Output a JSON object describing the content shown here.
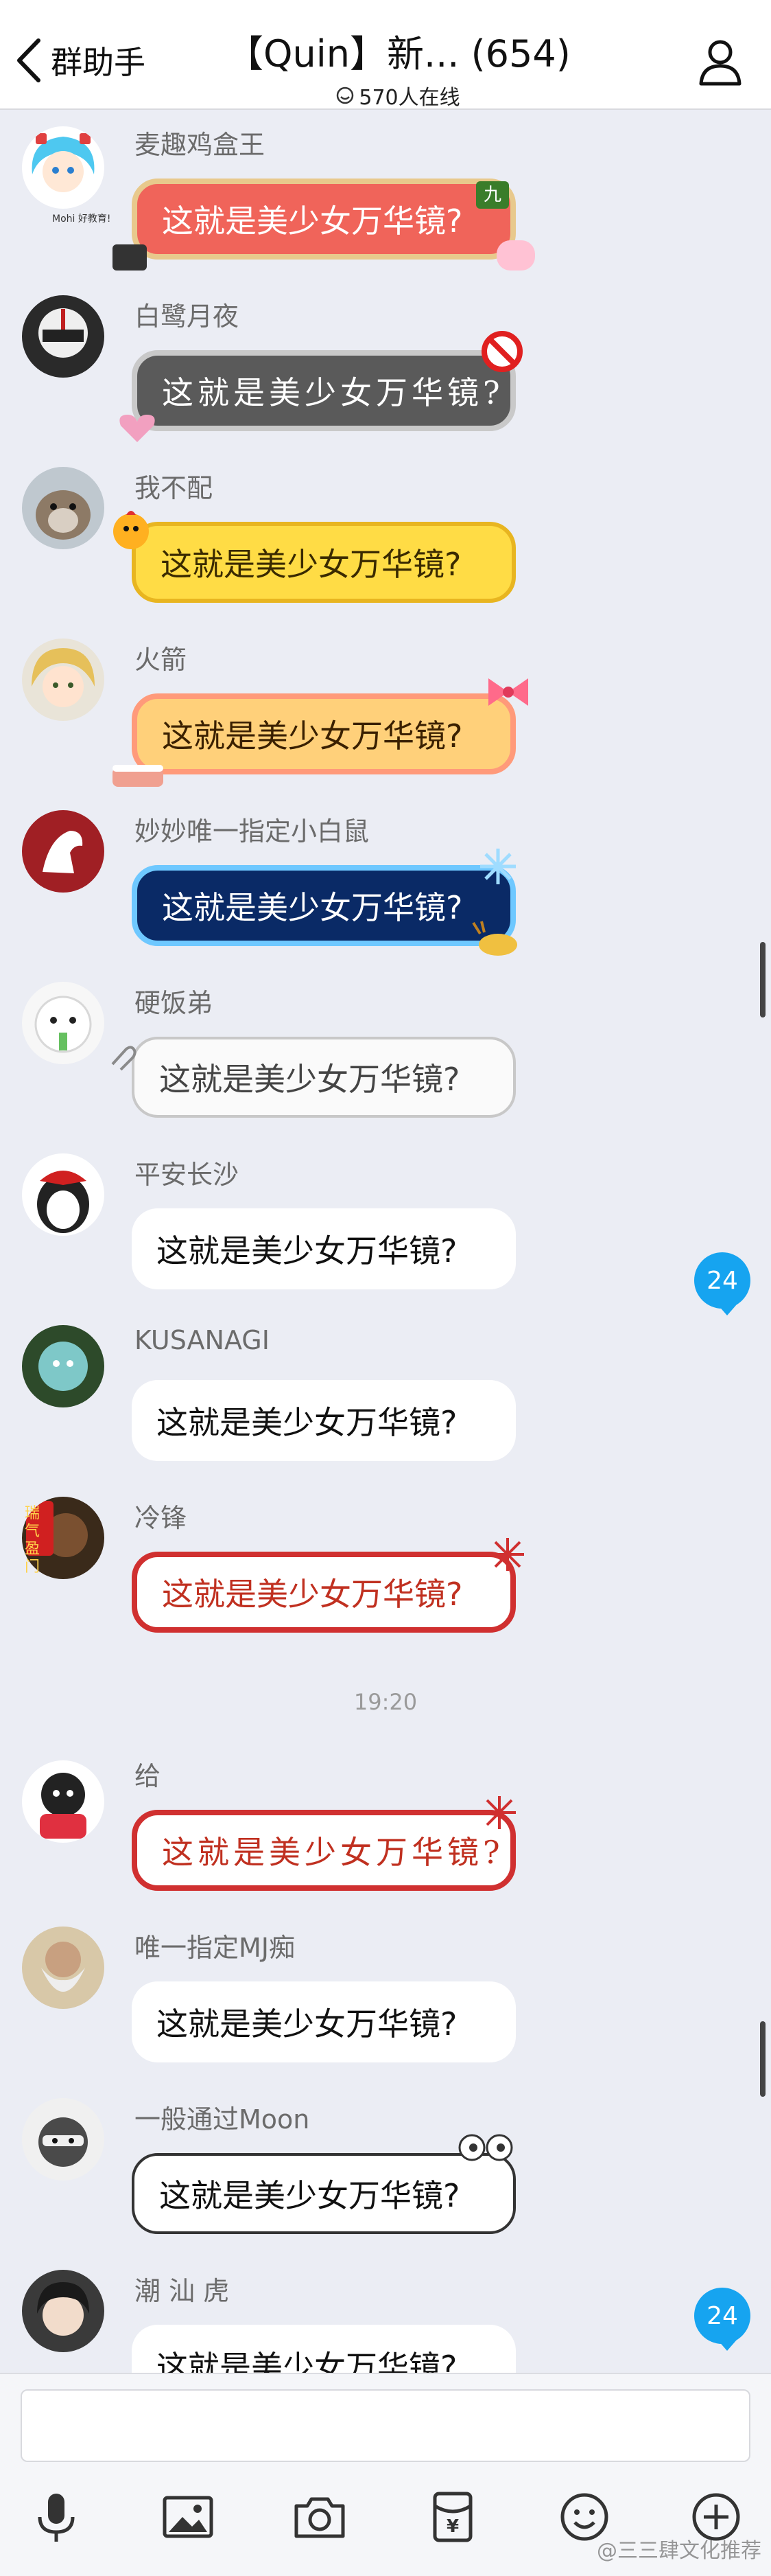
{
  "header": {
    "back_label": "群助手",
    "title": "【Quin】新... (654)",
    "online_count": "570人在线"
  },
  "messages": [
    {
      "sender": "麦趣鸡盒王",
      "text": "这就是美少女万华镜?"
    },
    {
      "sender": "白鹭月夜",
      "text": "这就是美少女万华镜?"
    },
    {
      "sender": "我不配",
      "text": "这就是美少女万华镜?"
    },
    {
      "sender": "火箭",
      "text": "这就是美少女万华镜?"
    },
    {
      "sender": "妙妙唯一指定小白鼠",
      "text": "这就是美少女万华镜?"
    },
    {
      "sender": "硬饭弟",
      "text": "这就是美少女万华镜?"
    },
    {
      "sender": "平安长沙",
      "text": "这就是美少女万华镜?"
    },
    {
      "sender": "KUSANAGI",
      "text": "这就是美少女万华镜?"
    },
    {
      "sender": "冷锋",
      "text": "这就是美少女万华镜?"
    },
    {
      "sender": "给",
      "text": "这就是美少女万华镜?"
    },
    {
      "sender": "唯一指定MJ痴",
      "text": "这就是美少女万华镜?"
    },
    {
      "sender": "一般通过Moon",
      "text": "这就是美少女万华镜?"
    },
    {
      "sender": "潮 汕 虎",
      "text": "这就是美少女万华镜?"
    }
  ],
  "timestamp": "19:20",
  "badges": [
    "24",
    "24"
  ],
  "stickers": {
    "bubble_tag": "九",
    "avatar_caption": "Mohi 好教育!",
    "festive_tag": "瑞气盈门"
  },
  "input": {
    "placeholder": ""
  },
  "toolbar": {
    "items": [
      "mic-icon",
      "image-icon",
      "camera-icon",
      "red-packet-icon",
      "emoji-icon",
      "add-icon"
    ],
    "red_packet_symbol": "¥"
  },
  "watermark": "@三三肆文化推荐",
  "colors": {
    "background": "#ebedf4",
    "badge": "#16a4f0",
    "bubble_white": "#ffffff"
  }
}
